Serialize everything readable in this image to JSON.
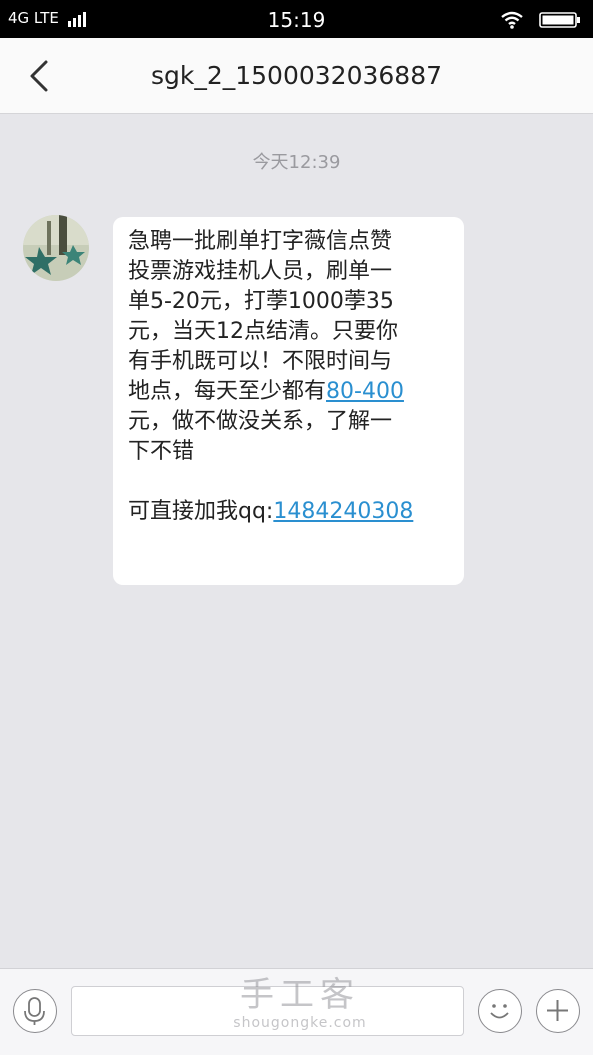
{
  "status_bar": {
    "network": "4G LTE",
    "time": "15:19"
  },
  "header": {
    "title": "sgk_2_1500032036887"
  },
  "conversation": {
    "timestamp": "今天12:39",
    "message": {
      "line1": "急聘一批刷单打字薇信点赞",
      "line2": "投票游戏挂机人员，刷单一",
      "line3": "单5-20元，打荸1000荸35",
      "line4": "元，当天12点结清。只要你",
      "line5": "有手机既可以！不限时间与",
      "line6_prefix": "地点，每天至少都有",
      "line6_link": "80-400",
      "line7": "元，做不做没关系，了解一",
      "line8": "下不错",
      "qq_prefix": "可直接加我qq:",
      "qq_link": "1484240308"
    }
  },
  "input_bar": {
    "placeholder": ""
  },
  "watermark": {
    "cn": "手工客",
    "en": "shougongke.com"
  },
  "colors": {
    "link": "#2a8fd0",
    "background": "#e6e6ea"
  },
  "icons": [
    "back-icon",
    "wifi-icon",
    "battery-icon",
    "microphone-icon",
    "emoji-icon",
    "plus-icon"
  ]
}
